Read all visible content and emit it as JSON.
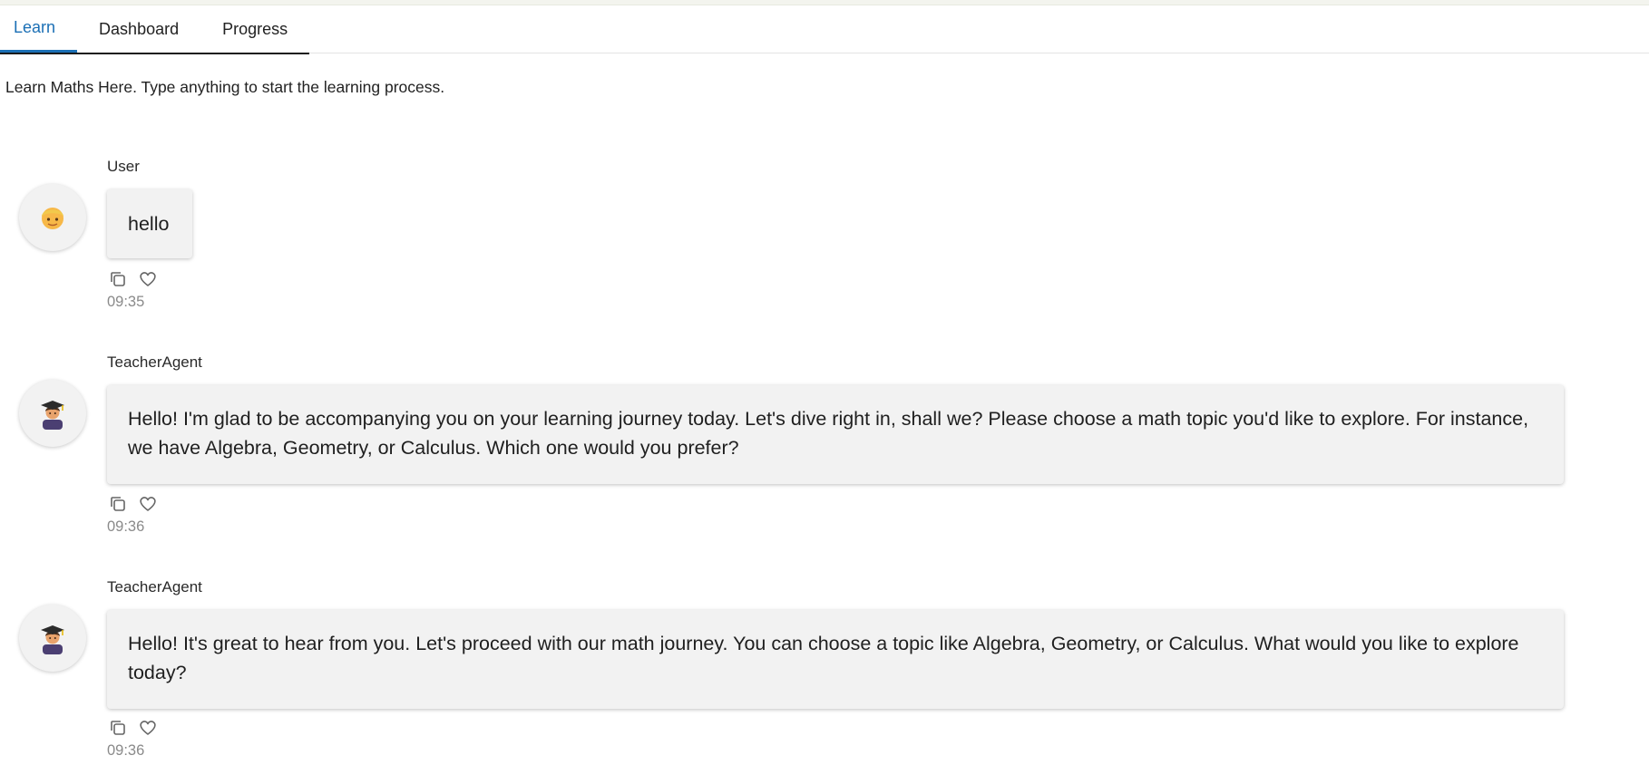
{
  "tabs": [
    {
      "label": "Learn",
      "active": true
    },
    {
      "label": "Dashboard",
      "active": false
    },
    {
      "label": "Progress",
      "active": false
    }
  ],
  "intro_text": "Learn Maths Here. Type anything to start the learning process.",
  "messages": [
    {
      "author": "User",
      "avatar": "person-blond-icon",
      "text": "hello",
      "time": "09:35"
    },
    {
      "author": "TeacherAgent",
      "avatar": "graduate-icon",
      "text": "Hello! I'm glad to be accompanying you on your learning journey today. Let's dive right in, shall we? Please choose a math topic you'd like to explore. For instance, we have Algebra, Geometry, or Calculus. Which one would you prefer?",
      "time": "09:36"
    },
    {
      "author": "TeacherAgent",
      "avatar": "graduate-icon",
      "text": "Hello! It's great to hear from you. Let's proceed with our math journey. You can choose a topic like Algebra, Geometry, or Calculus. What would you like to explore today?",
      "time": "09:36"
    }
  ],
  "icons": {
    "copy": "copy-icon",
    "like": "heart-icon"
  },
  "colors": {
    "accent": "#1b6fb5",
    "bubble": "#f2f2f2",
    "timestamp": "#8a8a8a"
  }
}
